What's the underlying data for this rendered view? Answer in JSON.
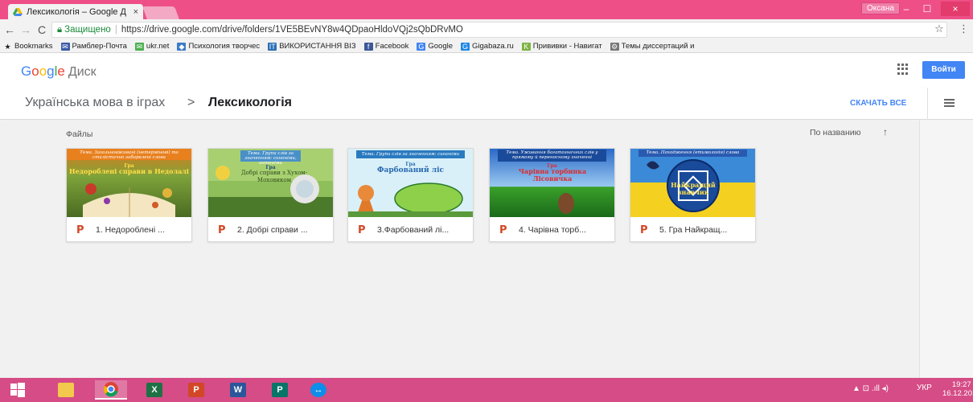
{
  "browser": {
    "tab_title": "Лексикологія – Google Д",
    "tab_close": "×",
    "user_chip": "Оксана",
    "win_min": "–",
    "win_max": "☐",
    "win_close": "×",
    "secure_label": "Защищено",
    "url": "https://drive.google.com/drive/folders/1VE5BEvNY8w4QDpaoHldoVQj2sQbDRvMO",
    "back": "←",
    "forward": "→",
    "reload": "C",
    "star": "☆",
    "menu": "⋮"
  },
  "bookmarks": [
    {
      "label": "Bookmarks",
      "icon": "star-icon",
      "color": "#222222",
      "glyph": "★"
    },
    {
      "label": "Рамблер-Почта",
      "icon": "mail-icon",
      "color": "#3b5aa6",
      "glyph": "✉"
    },
    {
      "label": "ukr.net",
      "icon": "envelope-icon",
      "color": "#4caf50",
      "glyph": "✉"
    },
    {
      "label": "Психология творчес",
      "icon": "bird-icon",
      "color": "#3b7bc8",
      "glyph": "◆"
    },
    {
      "label": "ВИКОРИСТАННЯ ВІЗ",
      "icon": "it-icon",
      "color": "#2c6fb5",
      "glyph": "IT"
    },
    {
      "label": "Facebook",
      "icon": "facebook-icon",
      "color": "#3b5998",
      "glyph": "f"
    },
    {
      "label": "Google",
      "icon": "google-icon",
      "color": "#4285f4",
      "glyph": "G"
    },
    {
      "label": "Gigabaza.ru",
      "icon": "gigabaza-icon",
      "color": "#1e88e5",
      "glyph": "G"
    },
    {
      "label": "Прививки - Навигат",
      "icon": "vaccine-icon",
      "color": "#7cb342",
      "glyph": "K"
    },
    {
      "label": "Темы диссертаций и",
      "icon": "dissertation-icon",
      "color": "#777777",
      "glyph": "⚙"
    }
  ],
  "drive": {
    "logo_google": [
      "G",
      "o",
      "o",
      "g",
      "l",
      "e"
    ],
    "logo_disk": "Диск",
    "signin": "Войти",
    "breadcrumb_parent": "Українська мова в іграх",
    "breadcrumb_sep": ">",
    "breadcrumb_current": "Лексикологія",
    "download_all": "СКАЧАТЬ ВСЕ",
    "files_label": "Файлы",
    "sort_label": "По названию",
    "sort_arrow": "↑"
  },
  "files": [
    {
      "name": "1. Недороблені ...",
      "thumb_caption": "Тема. Загальновживані (нетермінові) та стилістично забарвлені слова",
      "thumb_sub": "Гра",
      "thumb_title": "Недороблені справи в Недолалі"
    },
    {
      "name": "2. Добрі справи ...",
      "thumb_caption": "Тема. Групи слів за значенням: синоніми, антоніми",
      "thumb_sub": "Гра",
      "thumb_title": "Добрі справи з Хухом-Моховиком"
    },
    {
      "name": "3.Фарбований лі...",
      "thumb_caption": "Тема. Групи слів за значенням: синоніми",
      "thumb_sub": "Гра",
      "thumb_title": "Фарбований ліс"
    },
    {
      "name": "4. Чарівна торб...",
      "thumb_caption": "Тема. Уживання багатозначних слів у прямому й переносному значенні",
      "thumb_sub": "Гра",
      "thumb_title": "Чарівна торбинка Лісовичка"
    },
    {
      "name": "5. Гра Найкращ...",
      "thumb_caption": "Тема. Походження (етимологія) слова",
      "thumb_sub": "",
      "thumb_title": "Найкращий знавчик"
    }
  ],
  "taskbar": {
    "lang": "УКР",
    "time": "19:27",
    "date": "16.12.2017",
    "tray": "▲ ⊡ .ıll ◂)"
  }
}
